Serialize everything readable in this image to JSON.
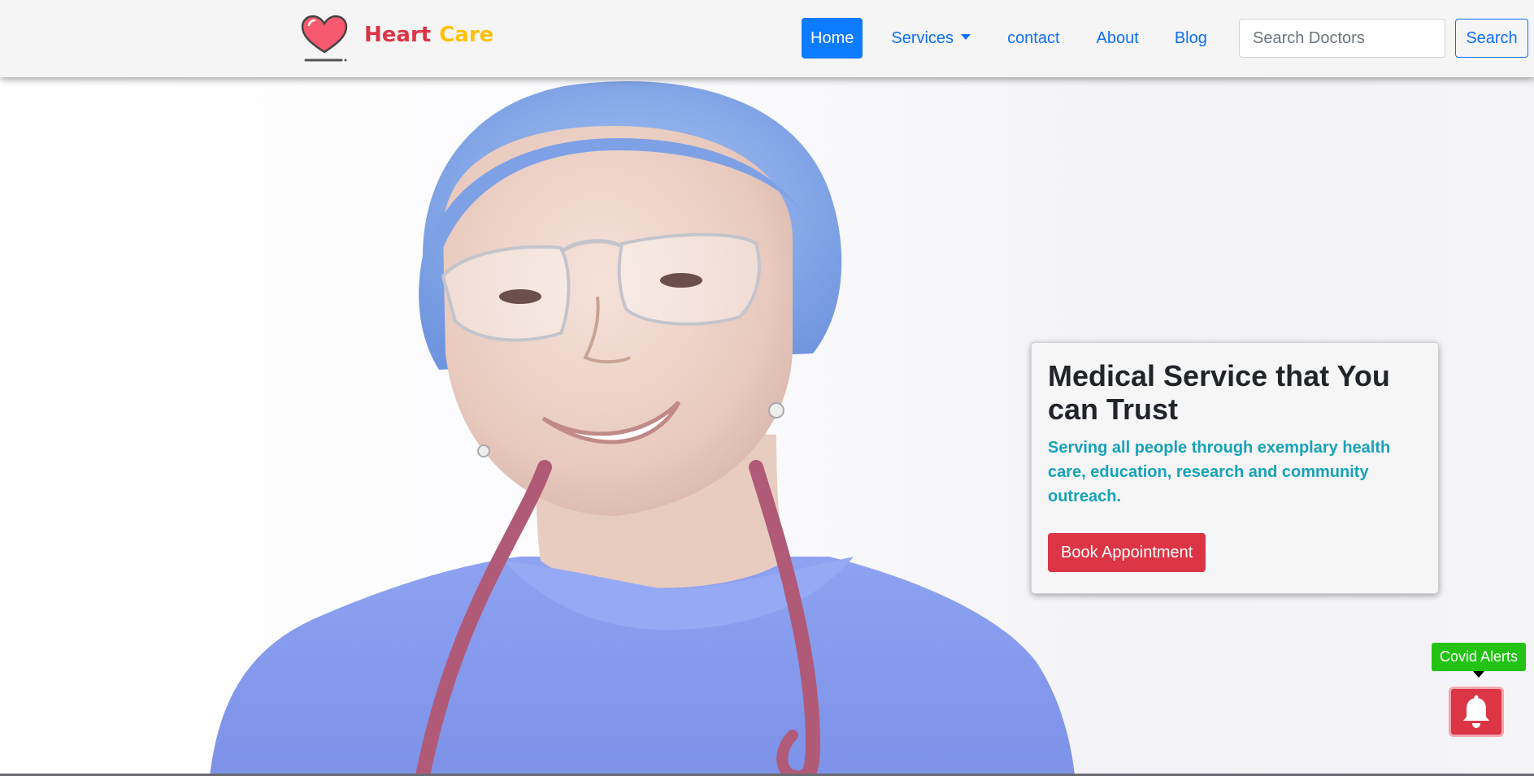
{
  "brand": {
    "name_part1": "Heart",
    "name_part2": "Care",
    "logo_icon": "heart-icon"
  },
  "nav": {
    "home": "Home",
    "services": "Services",
    "contact": "contact",
    "about": "About",
    "blog": "Blog"
  },
  "search": {
    "placeholder": "Search Doctors",
    "button": "Search"
  },
  "hero": {
    "title": "Medical Service that You can Trust",
    "subtitle": "Serving all people through exemplary health care, education, research and community outreach.",
    "cta": "Book Appointment",
    "image": "doctor-smiling-photo"
  },
  "alerts": {
    "label": "Covid Alerts",
    "icon": "bell-icon"
  },
  "colors": {
    "primary": "#0d6efd",
    "danger": "#dc3545",
    "warning": "#ffc107",
    "info": "#17a2b8",
    "success": "#22c313"
  }
}
